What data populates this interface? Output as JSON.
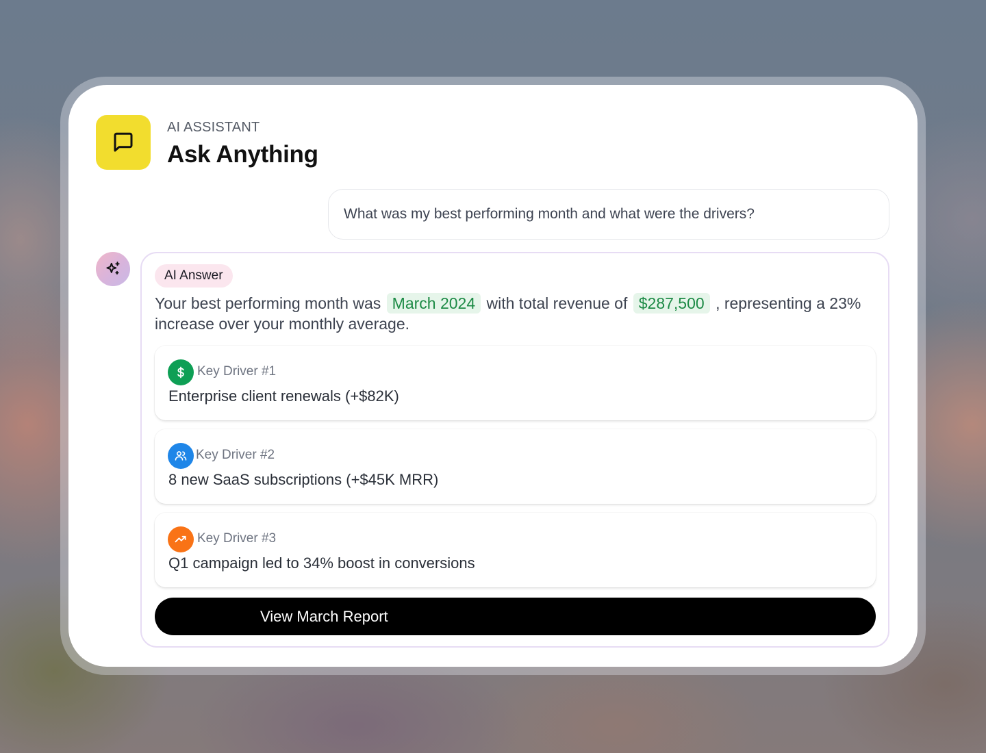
{
  "header": {
    "eyebrow": "AI ASSISTANT",
    "title": "Ask Anything",
    "icon": "chat-bubble-icon",
    "icon_bg": "#f2dd2e"
  },
  "question": {
    "text": "What was my best performing month and what were the drivers?"
  },
  "answer": {
    "avatar_icon": "sparkles-icon",
    "tag": "AI Answer",
    "summary": {
      "part1": "Your best performing month was",
      "month": "March 2024",
      "part2": "with total revenue of",
      "revenue": "$287,500",
      "part3": ", representing  a 23% increase over your monthly average."
    },
    "highlight_color": "#1c8a45",
    "drivers": [
      {
        "label": "Key Driver #1",
        "text": "Enterprise client renewals (+$82K)",
        "icon": "dollar-icon",
        "color": "#0e9f55"
      },
      {
        "label": "Key Driver #2",
        "text": "8 new SaaS subscriptions (+$45K MRR)",
        "icon": "users-icon",
        "color": "#1f86e8"
      },
      {
        "label": "Key Driver #3",
        "text": "Q1 campaign led to 34% boost in conversions",
        "icon": "trending-up-icon",
        "color": "#f97316"
      }
    ],
    "cta": "View March Report"
  }
}
